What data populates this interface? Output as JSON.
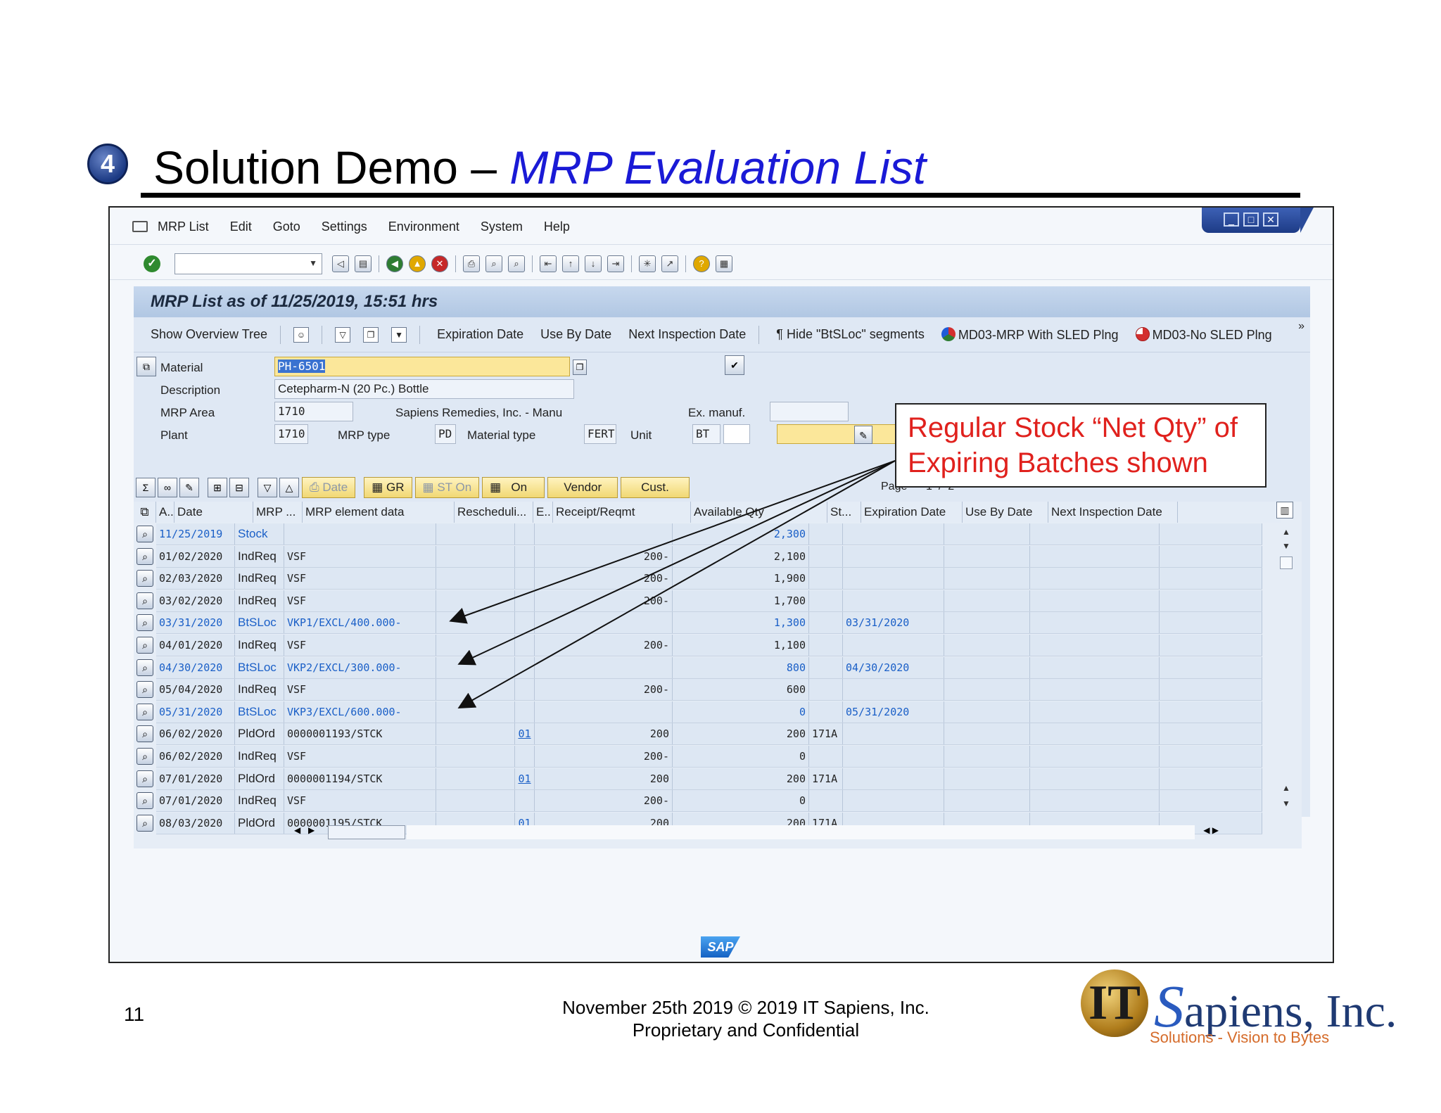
{
  "slide": {
    "step": "4",
    "title_plain": "Solution Demo – ",
    "title_accent": "MRP Evaluation List",
    "page_number": "11",
    "footer_line1": "November 25th  2019    © 2019 IT Sapiens, Inc.",
    "footer_line2": "Proprietary and Confidential",
    "logo_mark": "IT",
    "logo_text": "apiens, Inc.",
    "logo_initial": "S",
    "logo_tagline": "Solutions - Vision to Bytes"
  },
  "menu": [
    "MRP List",
    "Edit",
    "Goto",
    "Settings",
    "Environment",
    "System",
    "Help"
  ],
  "screen_title": "MRP List as of 11/25/2019, 15:51 hrs",
  "app_toolbar": {
    "show_overview_tree": "Show Overview Tree",
    "expiration_date": "Expiration Date",
    "use_by_date": "Use By Date",
    "next_inspection_date": "Next Inspection Date",
    "hide_segments": "¶ Hide \"BtSLoc\" segments",
    "md03_with_sled": "MD03-MRP With SLED Plng",
    "md03_no_sled": "MD03-No SLED Plng",
    "more": "»"
  },
  "header": {
    "material_label": "Material",
    "material_value": "PH-6501",
    "description_label": "Description",
    "description_value": "Cetepharm-N (20 Pc.) Bottle",
    "mrp_area_label": "MRP Area",
    "mrp_area_value": "1710",
    "mrp_area_text": "Sapiens Remedies, Inc. - Manu",
    "plant_label": "Plant",
    "plant_value": "1710",
    "mrp_type_label": "MRP type",
    "mrp_type_value": "PD",
    "material_type_label": "Material type",
    "material_type_value": "FERT",
    "unit_label": "Unit",
    "unit_value": "BT",
    "ex_manuf_label": "Ex. manuf."
  },
  "grid_toolbar": {
    "date_btn": "Date",
    "gr_btn": "GR",
    "st_on_btn": "ST On",
    "on_btn": "On",
    "vendor_btn": "Vendor",
    "cust_btn": "Cust.",
    "page_label": "Page",
    "page_current": "1",
    "page_sep": "/",
    "page_total": "2"
  },
  "columns": [
    "A..",
    "Date",
    "MRP ...",
    "MRP element data",
    "Rescheduli...",
    "E..",
    "Receipt/Reqmt",
    "Available Qty",
    "St...",
    "Expiration Date",
    "Use By Date",
    "Next Inspection Date"
  ],
  "rows": [
    {
      "date": "11/25/2019",
      "mrp": "Stock",
      "data": "",
      "resched": "",
      "e": "",
      "receipt": "",
      "avail": "2,300",
      "st": "",
      "exp": "",
      "blue": true
    },
    {
      "date": "01/02/2020",
      "mrp": "IndReq",
      "data": "VSF",
      "resched": "",
      "e": "",
      "receipt": "200-",
      "avail": "2,100",
      "st": "",
      "exp": "",
      "blue": false
    },
    {
      "date": "02/03/2020",
      "mrp": "IndReq",
      "data": "VSF",
      "resched": "",
      "e": "",
      "receipt": "200-",
      "avail": "1,900",
      "st": "",
      "exp": "",
      "blue": false
    },
    {
      "date": "03/02/2020",
      "mrp": "IndReq",
      "data": "VSF",
      "resched": "",
      "e": "",
      "receipt": "200-",
      "avail": "1,700",
      "st": "",
      "exp": "",
      "blue": false
    },
    {
      "date": "03/31/2020",
      "mrp": "BtSLoc",
      "data": "VKP1/EXCL/400.000-",
      "resched": "",
      "e": "",
      "receipt": "",
      "avail": "1,300",
      "st": "",
      "exp": "03/31/2020",
      "blue": true
    },
    {
      "date": "04/01/2020",
      "mrp": "IndReq",
      "data": "VSF",
      "resched": "",
      "e": "",
      "receipt": "200-",
      "avail": "1,100",
      "st": "",
      "exp": "",
      "blue": false
    },
    {
      "date": "04/30/2020",
      "mrp": "BtSLoc",
      "data": "VKP2/EXCL/300.000-",
      "resched": "",
      "e": "",
      "receipt": "",
      "avail": "800",
      "st": "",
      "exp": "04/30/2020",
      "blue": true
    },
    {
      "date": "05/04/2020",
      "mrp": "IndReq",
      "data": "VSF",
      "resched": "",
      "e": "",
      "receipt": "200-",
      "avail": "600",
      "st": "",
      "exp": "",
      "blue": false
    },
    {
      "date": "05/31/2020",
      "mrp": "BtSLoc",
      "data": "VKP3/EXCL/600.000-",
      "resched": "",
      "e": "",
      "receipt": "",
      "avail": "0",
      "st": "",
      "exp": "05/31/2020",
      "blue": true
    },
    {
      "date": "06/02/2020",
      "mrp": "PldOrd",
      "data": "0000001193/STCK",
      "resched": "",
      "e": "01",
      "receipt": "200",
      "avail": "200",
      "st": "171A",
      "exp": "",
      "blue": false
    },
    {
      "date": "06/02/2020",
      "mrp": "IndReq",
      "data": "VSF",
      "resched": "",
      "e": "",
      "receipt": "200-",
      "avail": "0",
      "st": "",
      "exp": "",
      "blue": false
    },
    {
      "date": "07/01/2020",
      "mrp": "PldOrd",
      "data": "0000001194/STCK",
      "resched": "",
      "e": "01",
      "receipt": "200",
      "avail": "200",
      "st": "171A",
      "exp": "",
      "blue": false
    },
    {
      "date": "07/01/2020",
      "mrp": "IndReq",
      "data": "VSF",
      "resched": "",
      "e": "",
      "receipt": "200-",
      "avail": "0",
      "st": "",
      "exp": "",
      "blue": false
    },
    {
      "date": "08/03/2020",
      "mrp": "PldOrd",
      "data": "0000001195/STCK",
      "resched": "",
      "e": "01",
      "receipt": "200",
      "avail": "200",
      "st": "171A",
      "exp": "",
      "blue": false
    }
  ],
  "callout": {
    "line1": "Regular Stock “Net Qty” of",
    "line2": "Expiring Batches shown",
    "color": "#e0211d"
  },
  "colors": {
    "accent": "#1a1ad6",
    "sap_blue": "#1a5fc7",
    "header_bar": "#b1c7e3"
  }
}
